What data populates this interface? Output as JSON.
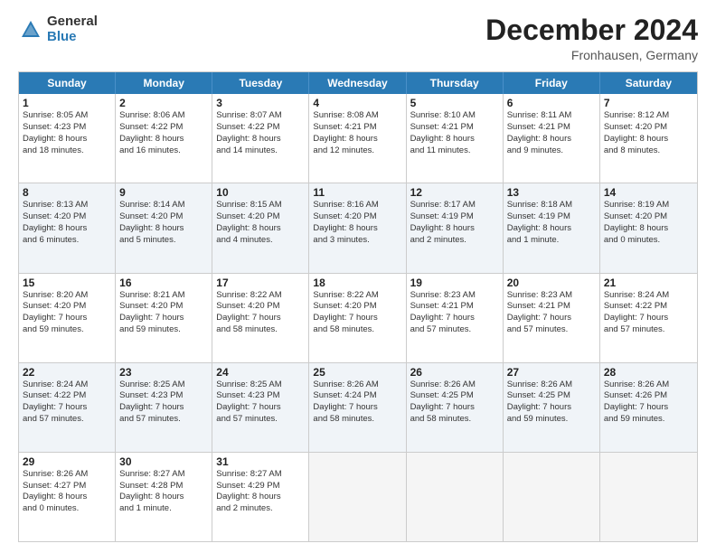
{
  "logo": {
    "general": "General",
    "blue": "Blue"
  },
  "title": "December 2024",
  "location": "Fronhausen, Germany",
  "days_of_week": [
    "Sunday",
    "Monday",
    "Tuesday",
    "Wednesday",
    "Thursday",
    "Friday",
    "Saturday"
  ],
  "rows": [
    [
      {
        "day": "1",
        "lines": [
          "Sunrise: 8:05 AM",
          "Sunset: 4:23 PM",
          "Daylight: 8 hours",
          "and 18 minutes."
        ],
        "empty": false
      },
      {
        "day": "2",
        "lines": [
          "Sunrise: 8:06 AM",
          "Sunset: 4:22 PM",
          "Daylight: 8 hours",
          "and 16 minutes."
        ],
        "empty": false
      },
      {
        "day": "3",
        "lines": [
          "Sunrise: 8:07 AM",
          "Sunset: 4:22 PM",
          "Daylight: 8 hours",
          "and 14 minutes."
        ],
        "empty": false
      },
      {
        "day": "4",
        "lines": [
          "Sunrise: 8:08 AM",
          "Sunset: 4:21 PM",
          "Daylight: 8 hours",
          "and 12 minutes."
        ],
        "empty": false
      },
      {
        "day": "5",
        "lines": [
          "Sunrise: 8:10 AM",
          "Sunset: 4:21 PM",
          "Daylight: 8 hours",
          "and 11 minutes."
        ],
        "empty": false
      },
      {
        "day": "6",
        "lines": [
          "Sunrise: 8:11 AM",
          "Sunset: 4:21 PM",
          "Daylight: 8 hours",
          "and 9 minutes."
        ],
        "empty": false
      },
      {
        "day": "7",
        "lines": [
          "Sunrise: 8:12 AM",
          "Sunset: 4:20 PM",
          "Daylight: 8 hours",
          "and 8 minutes."
        ],
        "empty": false
      }
    ],
    [
      {
        "day": "8",
        "lines": [
          "Sunrise: 8:13 AM",
          "Sunset: 4:20 PM",
          "Daylight: 8 hours",
          "and 6 minutes."
        ],
        "empty": false
      },
      {
        "day": "9",
        "lines": [
          "Sunrise: 8:14 AM",
          "Sunset: 4:20 PM",
          "Daylight: 8 hours",
          "and 5 minutes."
        ],
        "empty": false
      },
      {
        "day": "10",
        "lines": [
          "Sunrise: 8:15 AM",
          "Sunset: 4:20 PM",
          "Daylight: 8 hours",
          "and 4 minutes."
        ],
        "empty": false
      },
      {
        "day": "11",
        "lines": [
          "Sunrise: 8:16 AM",
          "Sunset: 4:20 PM",
          "Daylight: 8 hours",
          "and 3 minutes."
        ],
        "empty": false
      },
      {
        "day": "12",
        "lines": [
          "Sunrise: 8:17 AM",
          "Sunset: 4:19 PM",
          "Daylight: 8 hours",
          "and 2 minutes."
        ],
        "empty": false
      },
      {
        "day": "13",
        "lines": [
          "Sunrise: 8:18 AM",
          "Sunset: 4:19 PM",
          "Daylight: 8 hours",
          "and 1 minute."
        ],
        "empty": false
      },
      {
        "day": "14",
        "lines": [
          "Sunrise: 8:19 AM",
          "Sunset: 4:20 PM",
          "Daylight: 8 hours",
          "and 0 minutes."
        ],
        "empty": false
      }
    ],
    [
      {
        "day": "15",
        "lines": [
          "Sunrise: 8:20 AM",
          "Sunset: 4:20 PM",
          "Daylight: 7 hours",
          "and 59 minutes."
        ],
        "empty": false
      },
      {
        "day": "16",
        "lines": [
          "Sunrise: 8:21 AM",
          "Sunset: 4:20 PM",
          "Daylight: 7 hours",
          "and 59 minutes."
        ],
        "empty": false
      },
      {
        "day": "17",
        "lines": [
          "Sunrise: 8:22 AM",
          "Sunset: 4:20 PM",
          "Daylight: 7 hours",
          "and 58 minutes."
        ],
        "empty": false
      },
      {
        "day": "18",
        "lines": [
          "Sunrise: 8:22 AM",
          "Sunset: 4:20 PM",
          "Daylight: 7 hours",
          "and 58 minutes."
        ],
        "empty": false
      },
      {
        "day": "19",
        "lines": [
          "Sunrise: 8:23 AM",
          "Sunset: 4:21 PM",
          "Daylight: 7 hours",
          "and 57 minutes."
        ],
        "empty": false
      },
      {
        "day": "20",
        "lines": [
          "Sunrise: 8:23 AM",
          "Sunset: 4:21 PM",
          "Daylight: 7 hours",
          "and 57 minutes."
        ],
        "empty": false
      },
      {
        "day": "21",
        "lines": [
          "Sunrise: 8:24 AM",
          "Sunset: 4:22 PM",
          "Daylight: 7 hours",
          "and 57 minutes."
        ],
        "empty": false
      }
    ],
    [
      {
        "day": "22",
        "lines": [
          "Sunrise: 8:24 AM",
          "Sunset: 4:22 PM",
          "Daylight: 7 hours",
          "and 57 minutes."
        ],
        "empty": false
      },
      {
        "day": "23",
        "lines": [
          "Sunrise: 8:25 AM",
          "Sunset: 4:23 PM",
          "Daylight: 7 hours",
          "and 57 minutes."
        ],
        "empty": false
      },
      {
        "day": "24",
        "lines": [
          "Sunrise: 8:25 AM",
          "Sunset: 4:23 PM",
          "Daylight: 7 hours",
          "and 57 minutes."
        ],
        "empty": false
      },
      {
        "day": "25",
        "lines": [
          "Sunrise: 8:26 AM",
          "Sunset: 4:24 PM",
          "Daylight: 7 hours",
          "and 58 minutes."
        ],
        "empty": false
      },
      {
        "day": "26",
        "lines": [
          "Sunrise: 8:26 AM",
          "Sunset: 4:25 PM",
          "Daylight: 7 hours",
          "and 58 minutes."
        ],
        "empty": false
      },
      {
        "day": "27",
        "lines": [
          "Sunrise: 8:26 AM",
          "Sunset: 4:25 PM",
          "Daylight: 7 hours",
          "and 59 minutes."
        ],
        "empty": false
      },
      {
        "day": "28",
        "lines": [
          "Sunrise: 8:26 AM",
          "Sunset: 4:26 PM",
          "Daylight: 7 hours",
          "and 59 minutes."
        ],
        "empty": false
      }
    ],
    [
      {
        "day": "29",
        "lines": [
          "Sunrise: 8:26 AM",
          "Sunset: 4:27 PM",
          "Daylight: 8 hours",
          "and 0 minutes."
        ],
        "empty": false
      },
      {
        "day": "30",
        "lines": [
          "Sunrise: 8:27 AM",
          "Sunset: 4:28 PM",
          "Daylight: 8 hours",
          "and 1 minute."
        ],
        "empty": false
      },
      {
        "day": "31",
        "lines": [
          "Sunrise: 8:27 AM",
          "Sunset: 4:29 PM",
          "Daylight: 8 hours",
          "and 2 minutes."
        ],
        "empty": false
      },
      {
        "day": "",
        "lines": [],
        "empty": true
      },
      {
        "day": "",
        "lines": [],
        "empty": true
      },
      {
        "day": "",
        "lines": [],
        "empty": true
      },
      {
        "day": "",
        "lines": [],
        "empty": true
      }
    ]
  ]
}
